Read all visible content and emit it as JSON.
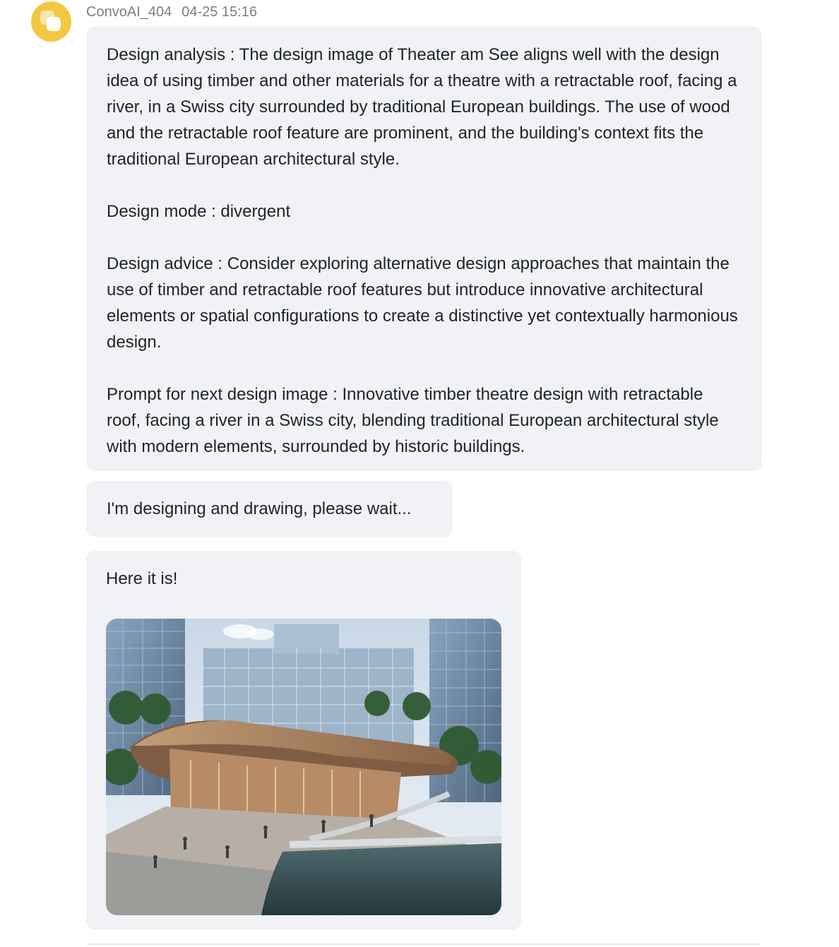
{
  "message": {
    "sender": "ConvoAI_404",
    "timestamp": "04-25 15:16",
    "main_bubble": {
      "analysis": "Design analysis : The design image of Theater am See aligns well with the design idea of using timber and other materials for a theatre with a retractable roof, facing a river, in a Swiss city surrounded by traditional European buildings. The use of wood and the retractable roof feature are prominent, and the building's context fits the traditional European architectural style.",
      "mode": "Design mode : divergent",
      "advice": "Design advice : Consider exploring alternative design approaches that maintain the use of timber and retractable roof features but introduce innovative architectural elements or spatial configurations to create a distinctive yet contextually harmonious design.",
      "prompt": "Prompt for next design image : Innovative timber theatre design with retractable roof, facing a river in a Swiss city, blending traditional European architectural style with modern elements, surrounded by historic buildings."
    },
    "wait_text": "I'm designing and drawing, please wait...",
    "result_text": "Here it is!",
    "result_image": {
      "icon": "architecture-render-image"
    }
  },
  "colors": {
    "avatar": "#f2c744",
    "bubble_background": "#f0f2f6",
    "meta_text": "#7b8088",
    "body_text": "#1f2329"
  }
}
